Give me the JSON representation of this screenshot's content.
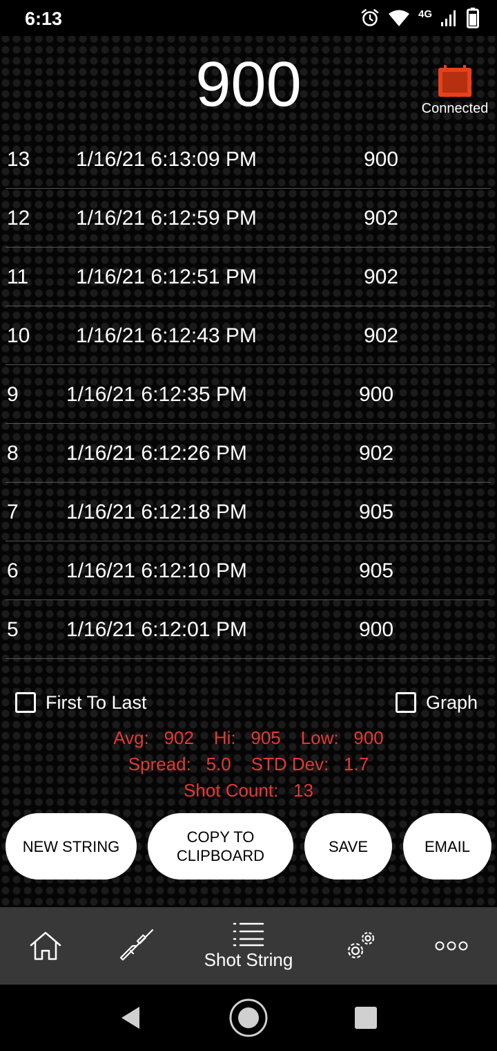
{
  "status_bar": {
    "time": "6:13",
    "network": "4G",
    "icons": [
      "alarm-icon",
      "wifi-icon",
      "signal-icon",
      "battery-icon"
    ]
  },
  "header": {
    "current_speed": "900",
    "connection_status": "Connected",
    "connection_color": "#e8401c"
  },
  "shots": [
    {
      "num": "13",
      "time": "1/16/21 6:13:09 PM",
      "velocity": "900"
    },
    {
      "num": "12",
      "time": "1/16/21 6:12:59 PM",
      "velocity": "902"
    },
    {
      "num": "11",
      "time": "1/16/21 6:12:51 PM",
      "velocity": "902"
    },
    {
      "num": "10",
      "time": "1/16/21 6:12:43 PM",
      "velocity": "902"
    },
    {
      "num": "9",
      "time": "1/16/21 6:12:35 PM",
      "velocity": "900"
    },
    {
      "num": "8",
      "time": "1/16/21 6:12:26 PM",
      "velocity": "902"
    },
    {
      "num": "7",
      "time": "1/16/21 6:12:18 PM",
      "velocity": "905"
    },
    {
      "num": "6",
      "time": "1/16/21 6:12:10 PM",
      "velocity": "905"
    },
    {
      "num": "5",
      "time": "1/16/21 6:12:01 PM",
      "velocity": "900"
    }
  ],
  "options": {
    "first_to_last": "First To Last",
    "graph": "Graph"
  },
  "stats": {
    "avg_label": "Avg:",
    "avg": "902",
    "hi_label": "Hi:",
    "hi": "905",
    "low_label": "Low:",
    "low": "900",
    "spread_label": "Spread:",
    "spread": "5.0",
    "std_label": "STD Dev:",
    "std": "1.7",
    "count_label": "Shot Count:",
    "count": "13",
    "color": "#e53935"
  },
  "actions": {
    "new_string": "NEW STRING",
    "copy_line1": "COPY TO",
    "copy_line2": "CLIPBOARD",
    "save": "SAVE",
    "email": "EMAIL"
  },
  "bottom_nav": {
    "items": [
      {
        "icon": "home-icon",
        "label": ""
      },
      {
        "icon": "rifle-icon",
        "label": ""
      },
      {
        "icon": "list-icon",
        "label": "Shot String"
      },
      {
        "icon": "gears-icon",
        "label": ""
      },
      {
        "icon": "more-icon",
        "label": ""
      }
    ],
    "active": "Shot String"
  },
  "system_nav": [
    "back-icon",
    "home-circle-icon",
    "recents-icon"
  ]
}
